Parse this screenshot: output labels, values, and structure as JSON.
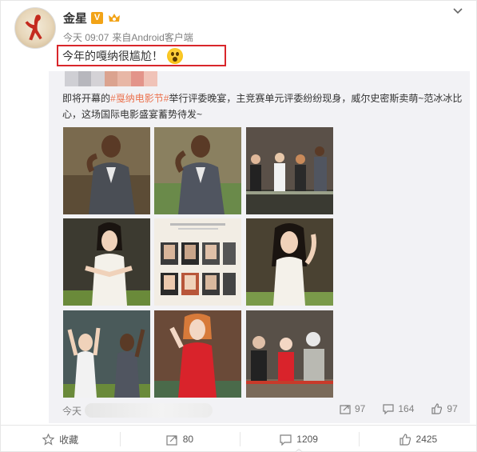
{
  "post": {
    "author": "金星",
    "verified_badge": "V",
    "time": "今天 09:07",
    "source_prefix": "来自",
    "source": "Android客户端",
    "text": "今年的嘎纳很尴尬！",
    "more_icon": "chevron-down-icon"
  },
  "repost": {
    "text_prefix": "即将开幕的",
    "hashtag": "#戛纳电影节#",
    "text_body": "举行评委晚宴，主竞赛单元评委纷纷现身，威尔史密斯卖萌~范冰冰比心，这场国际电影盛宴蓄势待发~",
    "time": "今天",
    "counts": {
      "repost": "97",
      "comment": "164",
      "like": "97"
    },
    "photos": [
      {
        "kind": "man-suit",
        "bg": "#7a6a4e"
      },
      {
        "kind": "man-suit",
        "bg": "#8a8060"
      },
      {
        "kind": "group",
        "bg": "#5a5048"
      },
      {
        "kind": "woman-white",
        "bg": "#3c3a30"
      },
      {
        "kind": "grid-collage",
        "bg": "#f2ede4"
      },
      {
        "kind": "woman-white",
        "bg": "#4a4232"
      },
      {
        "kind": "wave-pair",
        "bg": "#4a5a5a"
      },
      {
        "kind": "woman-red",
        "bg": "#6a4a38"
      },
      {
        "kind": "group-red",
        "bg": "#585048"
      }
    ]
  },
  "actions": {
    "favorite": "收藏",
    "repost": "80",
    "comment": "1209",
    "like": "2425"
  },
  "colors": {
    "accent": "#eb7350",
    "highlight_box": "#d9262b",
    "verified": "#f2a317",
    "repost_bg": "#f2f2f5"
  }
}
